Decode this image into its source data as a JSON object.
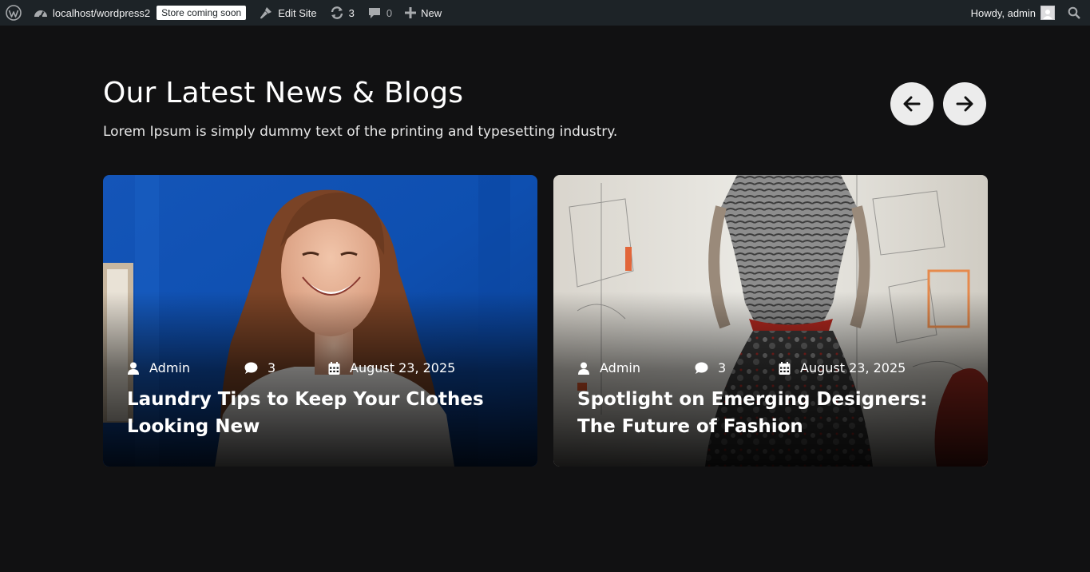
{
  "adminbar": {
    "site_url": "localhost/wordpress2",
    "store_badge": "Store coming soon",
    "edit_site": "Edit Site",
    "updates_count": "3",
    "comments_count": "0",
    "new_label": "New",
    "howdy": "Howdy, admin"
  },
  "section": {
    "title": "Our Latest News & Blogs",
    "subtitle": "Lorem Ipsum is simply dummy text of the printing and typesetting industry."
  },
  "posts": [
    {
      "author": "Admin",
      "comments": "3",
      "date": "August 23, 2025",
      "title": "Laundry Tips to Keep Your Clothes Looking New"
    },
    {
      "author": "Admin",
      "comments": "3",
      "date": "August 23, 2025",
      "title": "Spotlight on Emerging Designers: The Future of Fashion"
    }
  ],
  "colors": {
    "page_bg": "#111112",
    "adminbar_bg": "#1d2327",
    "nav_button_bg": "#ececec"
  }
}
